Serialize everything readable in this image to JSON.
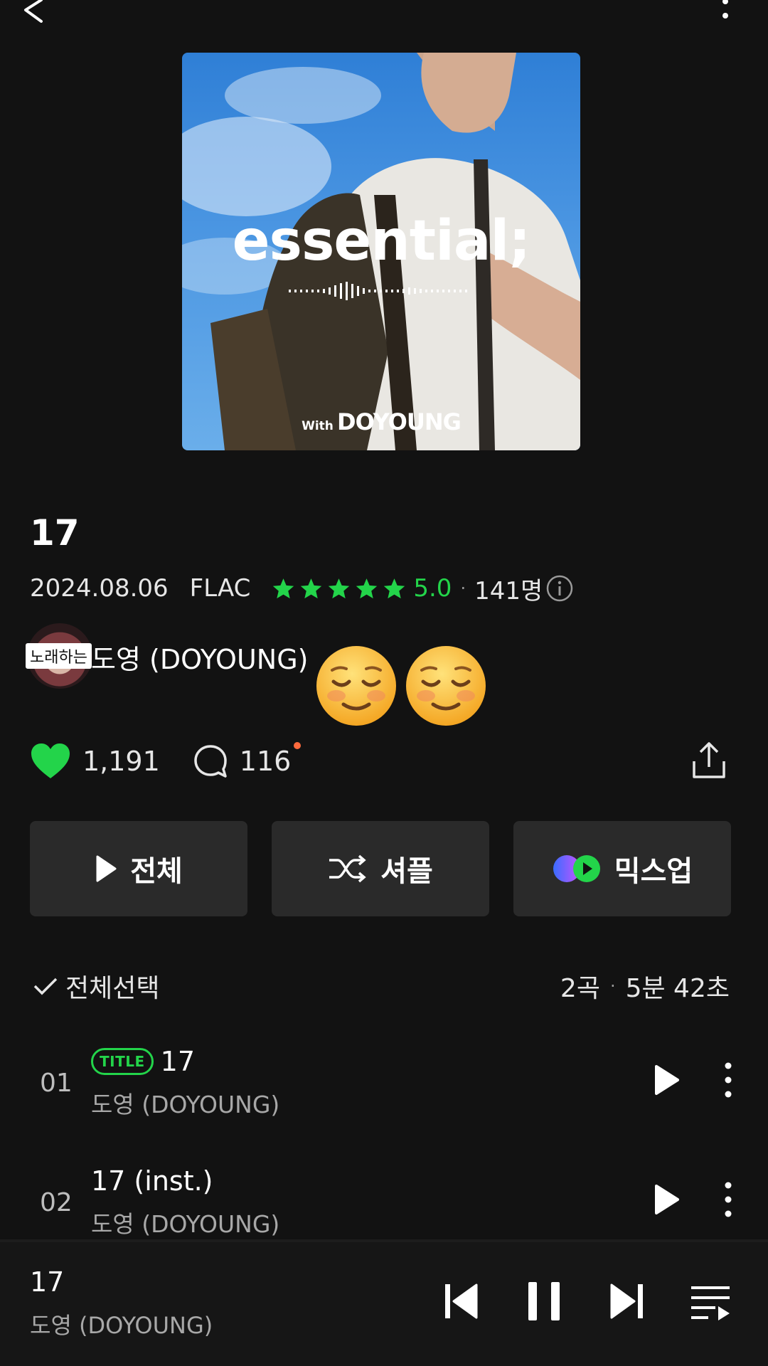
{
  "header": {
    "back_icon": "chevron-left-icon",
    "more_icon": "more-vertical-icon"
  },
  "cover": {
    "title": "essential;",
    "with_prefix": "With",
    "with_artist": "DOYOUNG"
  },
  "album": {
    "title": "17",
    "date": "2024.08.06",
    "format": "FLAC",
    "rating_value": 5.0,
    "rating_text": "5.0",
    "rating_separator": "·",
    "rating_count": "141명",
    "star_color": "#23d44a"
  },
  "artist": {
    "tag": "노래하는",
    "name": "도영 (DOYOUNG)",
    "emoji": "smiling-face-emoji"
  },
  "stats": {
    "likes": "1,191",
    "comments": "116",
    "heart_color": "#23d44a",
    "new_dot_color": "#ff6a3d"
  },
  "actions": {
    "play_all": "전체",
    "shuffle": "셔플",
    "mixup": "믹스업"
  },
  "list_header": {
    "select_all": "전체선택",
    "song_count": "2곡",
    "separator": "·",
    "duration": "5분 42초"
  },
  "tracks": [
    {
      "number": "01",
      "badge": "TITLE",
      "title": "17",
      "artist": "도영 (DOYOUNG)"
    },
    {
      "number": "02",
      "badge": "",
      "title": "17 (inst.)",
      "artist": "도영 (DOYOUNG)"
    }
  ],
  "now_playing": {
    "title": "17",
    "artist": "도영 (DOYOUNG)"
  }
}
